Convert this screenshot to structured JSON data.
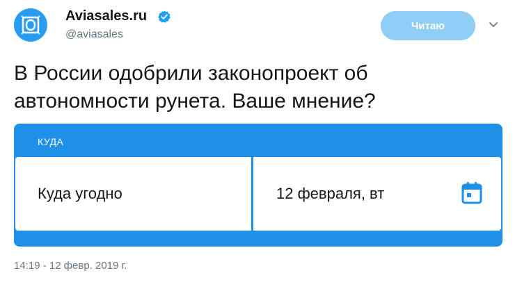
{
  "author": {
    "name": "Aviasales.ru",
    "handle": "@aviasales",
    "verified": true
  },
  "follow_button": {
    "label": "Читаю"
  },
  "tweet": {
    "text_line1": "В России одобрили законопроект об",
    "text_line2": "автономности рунета. Ваше мнение?",
    "timestamp": "14:19 - 12 февр. 2019 г."
  },
  "card": {
    "section_label": "КУДА",
    "destination": "Куда угодно",
    "date": "12 февраля, вт"
  },
  "colors": {
    "accent": "#1e90e8",
    "follow_bg": "#90cdf7",
    "verified": "#1da1f2",
    "muted": "#657786"
  },
  "icons": [
    "chevron-down-icon",
    "verified-badge-icon",
    "calendar-icon",
    "aviasales-logo-icon"
  ]
}
